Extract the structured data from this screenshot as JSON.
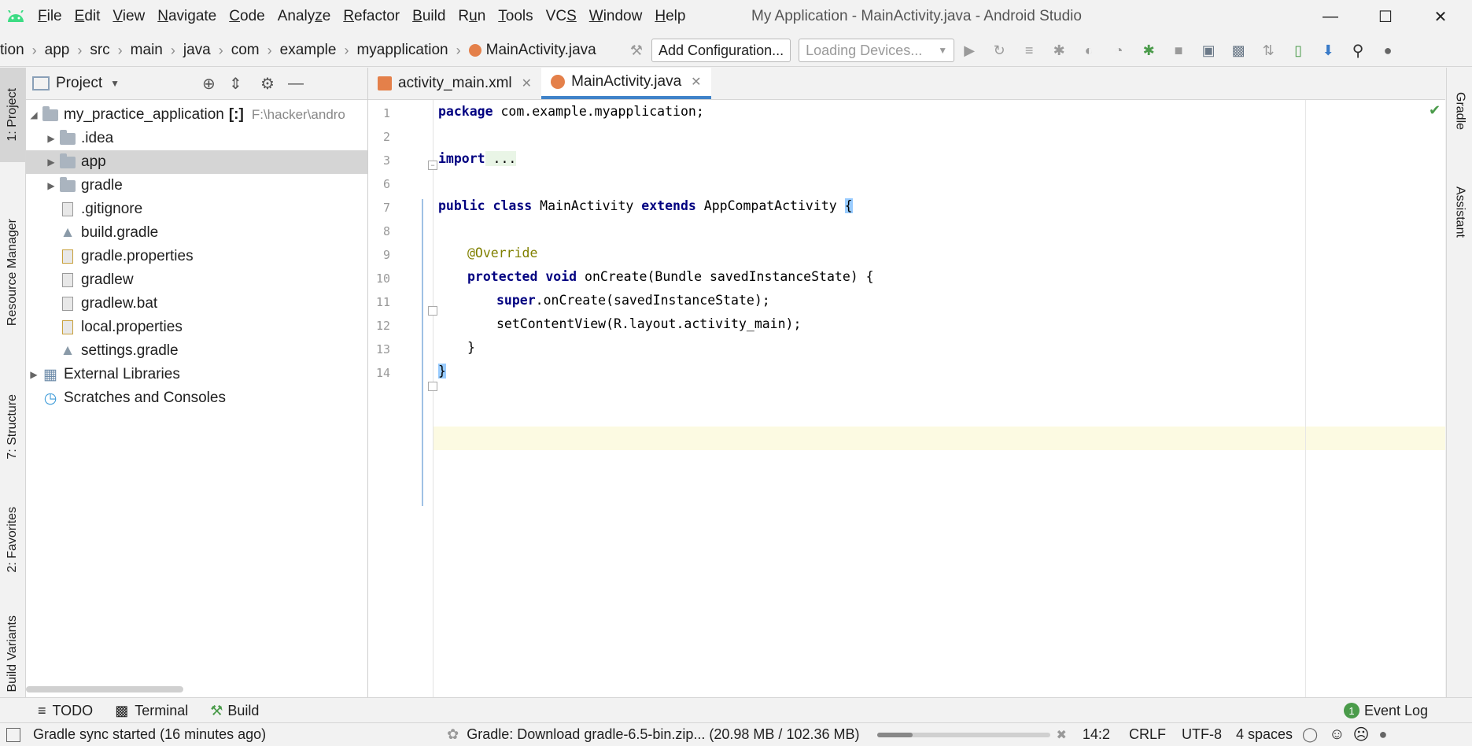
{
  "window": {
    "title": "My Application - MainActivity.java - Android Studio"
  },
  "menu": [
    {
      "prefix": "",
      "mnemonic": "F",
      "rest": "ile"
    },
    {
      "prefix": "",
      "mnemonic": "E",
      "rest": "dit"
    },
    {
      "prefix": "",
      "mnemonic": "V",
      "rest": "iew"
    },
    {
      "prefix": "",
      "mnemonic": "N",
      "rest": "avigate"
    },
    {
      "prefix": "",
      "mnemonic": "C",
      "rest": "ode"
    },
    {
      "prefix": "Analy",
      "mnemonic": "z",
      "rest": "e"
    },
    {
      "prefix": "",
      "mnemonic": "R",
      "rest": "efactor"
    },
    {
      "prefix": "",
      "mnemonic": "B",
      "rest": "uild"
    },
    {
      "prefix": "R",
      "mnemonic": "u",
      "rest": "n"
    },
    {
      "prefix": "",
      "mnemonic": "T",
      "rest": "ools"
    },
    {
      "prefix": "VC",
      "mnemonic": "S",
      "rest": ""
    },
    {
      "prefix": "",
      "mnemonic": "W",
      "rest": "indow"
    },
    {
      "prefix": "",
      "mnemonic": "H",
      "rest": "elp"
    }
  ],
  "breadcrumb": [
    "tion",
    "app",
    "src",
    "main",
    "java",
    "com",
    "example",
    "myapplication",
    "MainActivity.java"
  ],
  "toolbar": {
    "add_config": "Add Configuration...",
    "devices": "Loading Devices..."
  },
  "left_strip": {
    "project": "1: Project",
    "resource_manager": "Resource Manager",
    "structure": "7: Structure",
    "favorites": "2: Favorites",
    "build_variants": "Build Variants"
  },
  "right_strip": {
    "gradle": "Gradle",
    "assistant": "Assistant"
  },
  "project_panel": {
    "title": "Project",
    "tree": [
      {
        "label": "my_practice_application",
        "extra": "[:]",
        "path": "F:\\hacker\\andro"
      },
      {
        "label": ".idea"
      },
      {
        "label": "app"
      },
      {
        "label": "gradle"
      },
      {
        "label": ".gitignore"
      },
      {
        "label": "build.gradle"
      },
      {
        "label": "gradle.properties"
      },
      {
        "label": "gradlew"
      },
      {
        "label": "gradlew.bat"
      },
      {
        "label": "local.properties"
      },
      {
        "label": "settings.gradle"
      },
      {
        "label": "External Libraries"
      },
      {
        "label": "Scratches and Consoles"
      }
    ]
  },
  "editor": {
    "tabs": [
      {
        "label": "activity_main.xml"
      },
      {
        "label": "MainActivity.java"
      }
    ],
    "line_numbers": [
      "1",
      "2",
      "3",
      "6",
      "7",
      "8",
      "9",
      "10",
      "11",
      "12",
      "13",
      "14"
    ],
    "code": {
      "l1a": "package",
      "l1b": " com.example.myapplication;",
      "l3a": "import",
      "l3b": " ...",
      "l7a": "public class",
      "l7b": " MainActivity ",
      "l7c": "extends",
      "l7d": " AppCompatActivity ",
      "l7e": "{",
      "l9": "@Override",
      "l10a": "protected void",
      "l10b": " onCreate(Bundle savedInstanceState) {",
      "l11a": "super",
      "l11b": ".onCreate(savedInstanceState);",
      "l12": "setContentView(R.layout.activity_main);",
      "l13": "}",
      "l14": "}"
    }
  },
  "bottom_tools": {
    "todo": "TODO",
    "terminal": "Terminal",
    "build": "Build",
    "event_log": "Event Log",
    "event_count": "1"
  },
  "status": {
    "message": "Gradle sync started (16 minutes ago)",
    "download": "Gradle: Download gradle-6.5-bin.zip...  (20.98 MB / 102.36 MB)",
    "download_progress": 0.205,
    "position": "14:2",
    "line_ending": "CRLF",
    "encoding": "UTF-8",
    "indent": "4 spaces"
  },
  "colors": {
    "keyword": "#000080",
    "annotation": "#808000",
    "active_tab_underline": "#4083c9",
    "caret_line": "#fcfae2"
  }
}
